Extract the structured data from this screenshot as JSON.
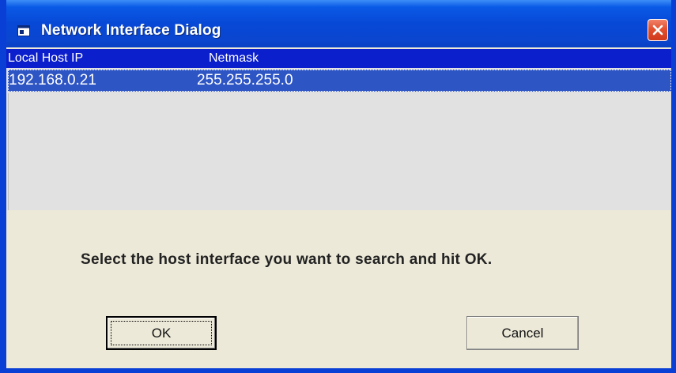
{
  "window": {
    "title": "Network Interface Dialog",
    "close_icon": "close-x-icon",
    "app_icon": "window-app-icon"
  },
  "list": {
    "columns": [
      "Local Host IP",
      "Netmask"
    ],
    "rows": [
      {
        "ip": "192.168.0.21",
        "netmask": "255.255.255.0",
        "selected": true
      }
    ]
  },
  "message": "Select the host interface you want to search and hit OK.",
  "buttons": {
    "ok": "OK",
    "cancel": "Cancel"
  },
  "colors": {
    "titlebar": "#0748d6",
    "header": "#0c1fcc",
    "selection": "#2e55c4",
    "close": "#e2502f",
    "dialog_bg": "#ece9d8"
  }
}
